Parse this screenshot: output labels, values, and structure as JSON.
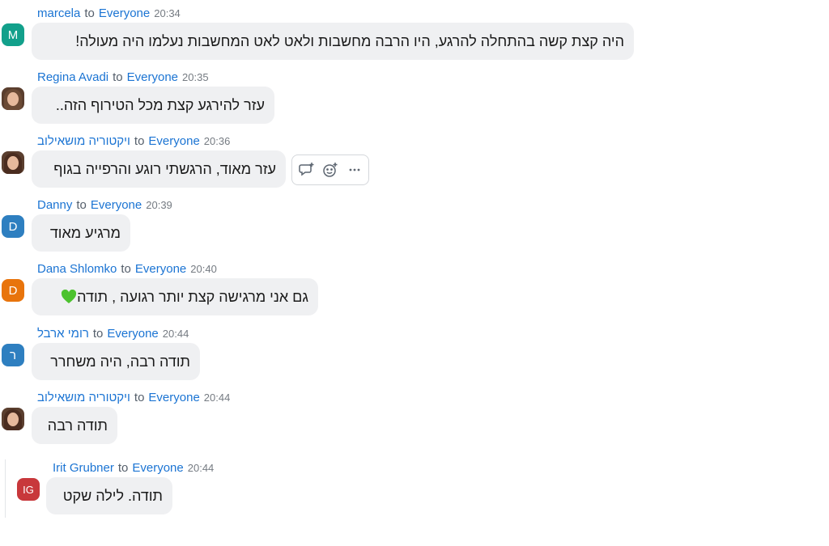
{
  "recipient_label": "to",
  "audience": "Everyone",
  "messages": [
    {
      "sender": "marcela",
      "time": "20:34",
      "avatar": "M",
      "avatar_color": "#12a08b",
      "text": "היה קצת קשה בהתחלה להרגע, היו הרבה מחשבות ולאט לאט המחשבות נעלמו היה מעולה!"
    },
    {
      "sender": "Regina Avadi",
      "time": "20:35",
      "avatar": "photo",
      "avatar_color": "#6b4a35",
      "text": "עזר להירגע קצת מכל הטירוף הזה.."
    },
    {
      "sender": "ויקטוריה מושאילוב",
      "time": "20:36",
      "avatar": "photo",
      "avatar_color": "#4a2c1f",
      "text": "עזר מאוד, הרגשתי רוגע והרפייה בגוף"
    },
    {
      "sender": "Danny",
      "time": "20:39",
      "avatar": "D",
      "avatar_color": "#2e7fc0",
      "text": "מרגיע מאוד"
    },
    {
      "sender": "Dana Shlomko",
      "time": "20:40",
      "avatar": "D",
      "avatar_color": "#e8740c",
      "text": "גם אני מרגישה קצת יותר רגועה , תודה",
      "emoji": "green-heart"
    },
    {
      "sender": "רומי ארבל",
      "time": "20:44",
      "avatar": "ר",
      "avatar_color": "#2e7fc0",
      "text": "תודה רבה, היה משחרר"
    },
    {
      "sender": "ויקטוריה מושאילוב",
      "time": "20:44",
      "avatar": "photo",
      "avatar_color": "#4a2c1f",
      "text": "תודה רבה"
    },
    {
      "sender": "Irit Grubner",
      "time": "20:44",
      "avatar": "IG",
      "avatar_color": "#c8383b",
      "text": "תודה. לילה שקט",
      "reply": true
    }
  ],
  "hover_actions": [
    "reply-in-thread-icon",
    "add-reaction-icon",
    "more-icon"
  ],
  "accent_color": "#1b74d3"
}
